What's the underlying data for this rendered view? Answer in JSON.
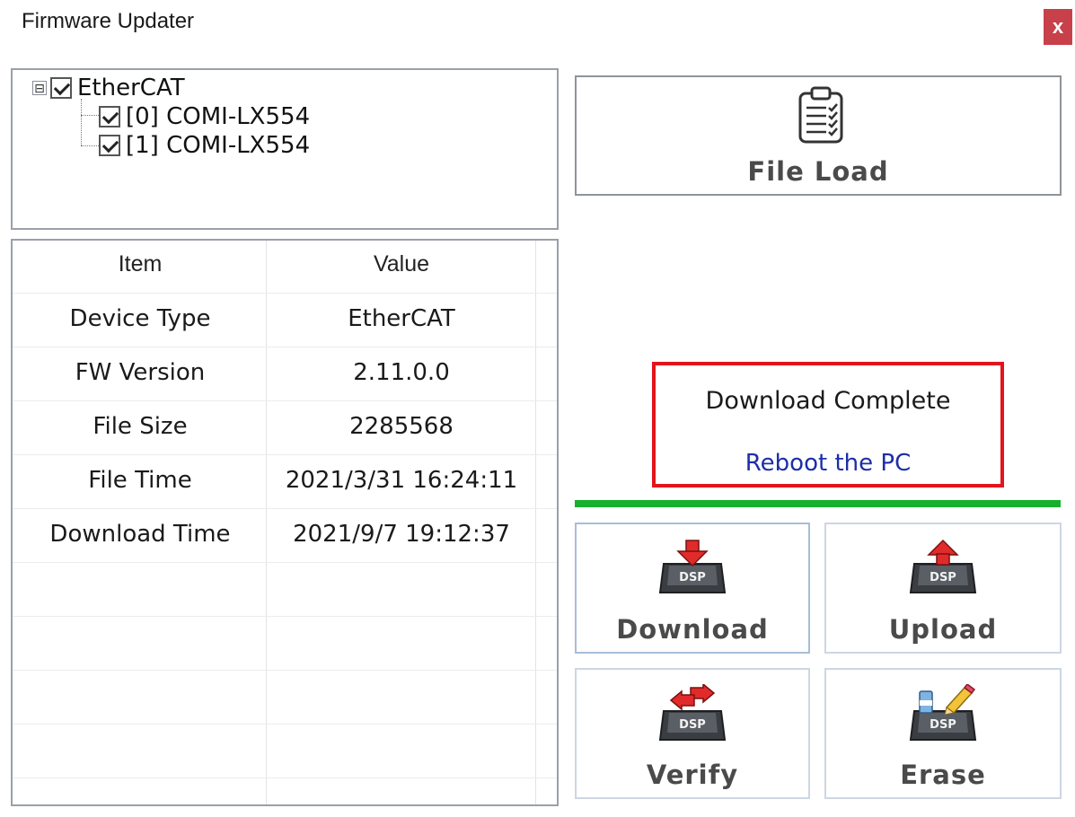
{
  "window": {
    "title": "Firmware Updater",
    "close_label": "x"
  },
  "tree": {
    "root": {
      "label": "EtherCAT",
      "checked": true,
      "expanded": true,
      "expander_glyph": "⊟"
    },
    "children": [
      {
        "label": "[0] COMI-LX554",
        "checked": true
      },
      {
        "label": "[1] COMI-LX554",
        "checked": true
      }
    ]
  },
  "info_table": {
    "headers": {
      "item": "Item",
      "value": "Value"
    },
    "rows": [
      {
        "item": "Device Type",
        "value": "EtherCAT"
      },
      {
        "item": "FW Version",
        "value": "2.11.0.0"
      },
      {
        "item": "File Size",
        "value": "2285568"
      },
      {
        "item": "File Time",
        "value": "2021/3/31 16:24:11"
      },
      {
        "item": "Download Time",
        "value": "2021/9/7 19:12:37"
      }
    ]
  },
  "buttons": {
    "file_load": {
      "label": "File Load",
      "icon": "clipboard-icon"
    },
    "download": {
      "label": "Download",
      "icon": "dsp-download-icon"
    },
    "upload": {
      "label": "Upload",
      "icon": "dsp-upload-icon"
    },
    "verify": {
      "label": "Verify",
      "icon": "dsp-verify-icon"
    },
    "erase": {
      "label": "Erase",
      "icon": "dsp-erase-icon"
    },
    "dsp_chip_text": "DSP"
  },
  "status": {
    "message": "Download Complete",
    "instruction": "Reboot the PC",
    "progress_percent": 100,
    "colors": {
      "border": "#e3141b",
      "instruction_text": "#1c2ea8",
      "progress": "#16b02c"
    }
  }
}
